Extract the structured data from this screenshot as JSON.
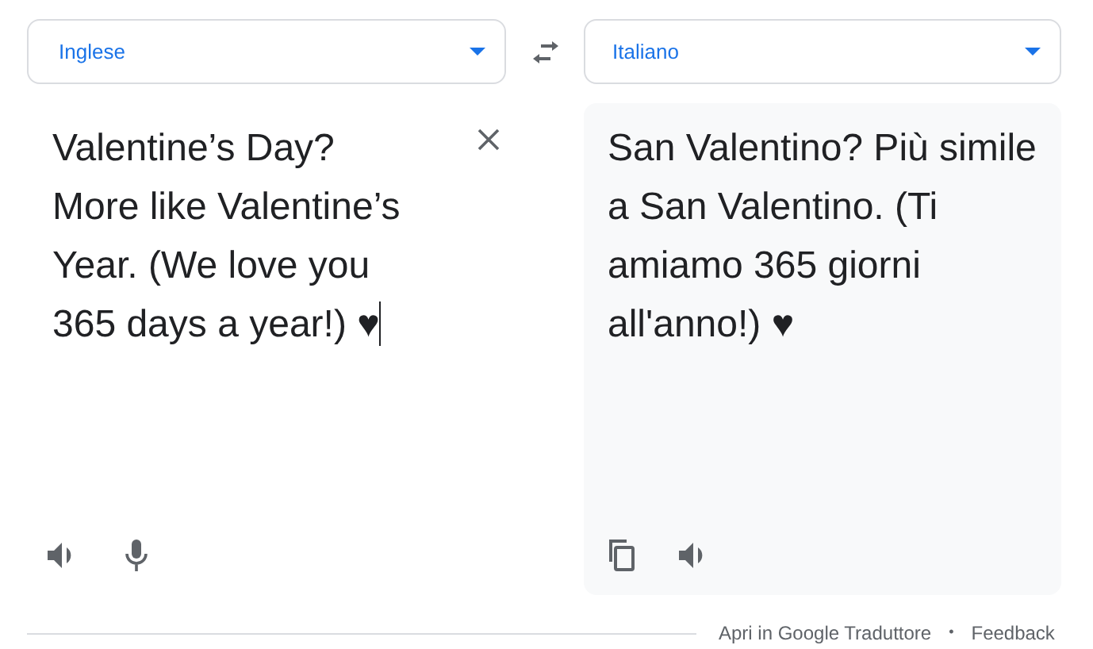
{
  "source_language": {
    "label": "Inglese"
  },
  "target_language": {
    "label": "Italiano"
  },
  "source_text": "Valentine’s Day? More like Valentine’s Year. (We love you 365 days a year!) ♥",
  "translation": "San Valentino? Più simile a San Valentino. (Ti amiamo 365 giorni all'anno!) ♥",
  "footer": {
    "links": [
      "Apri in Google Traduttore",
      "Feedback"
    ],
    "separator": "•"
  }
}
